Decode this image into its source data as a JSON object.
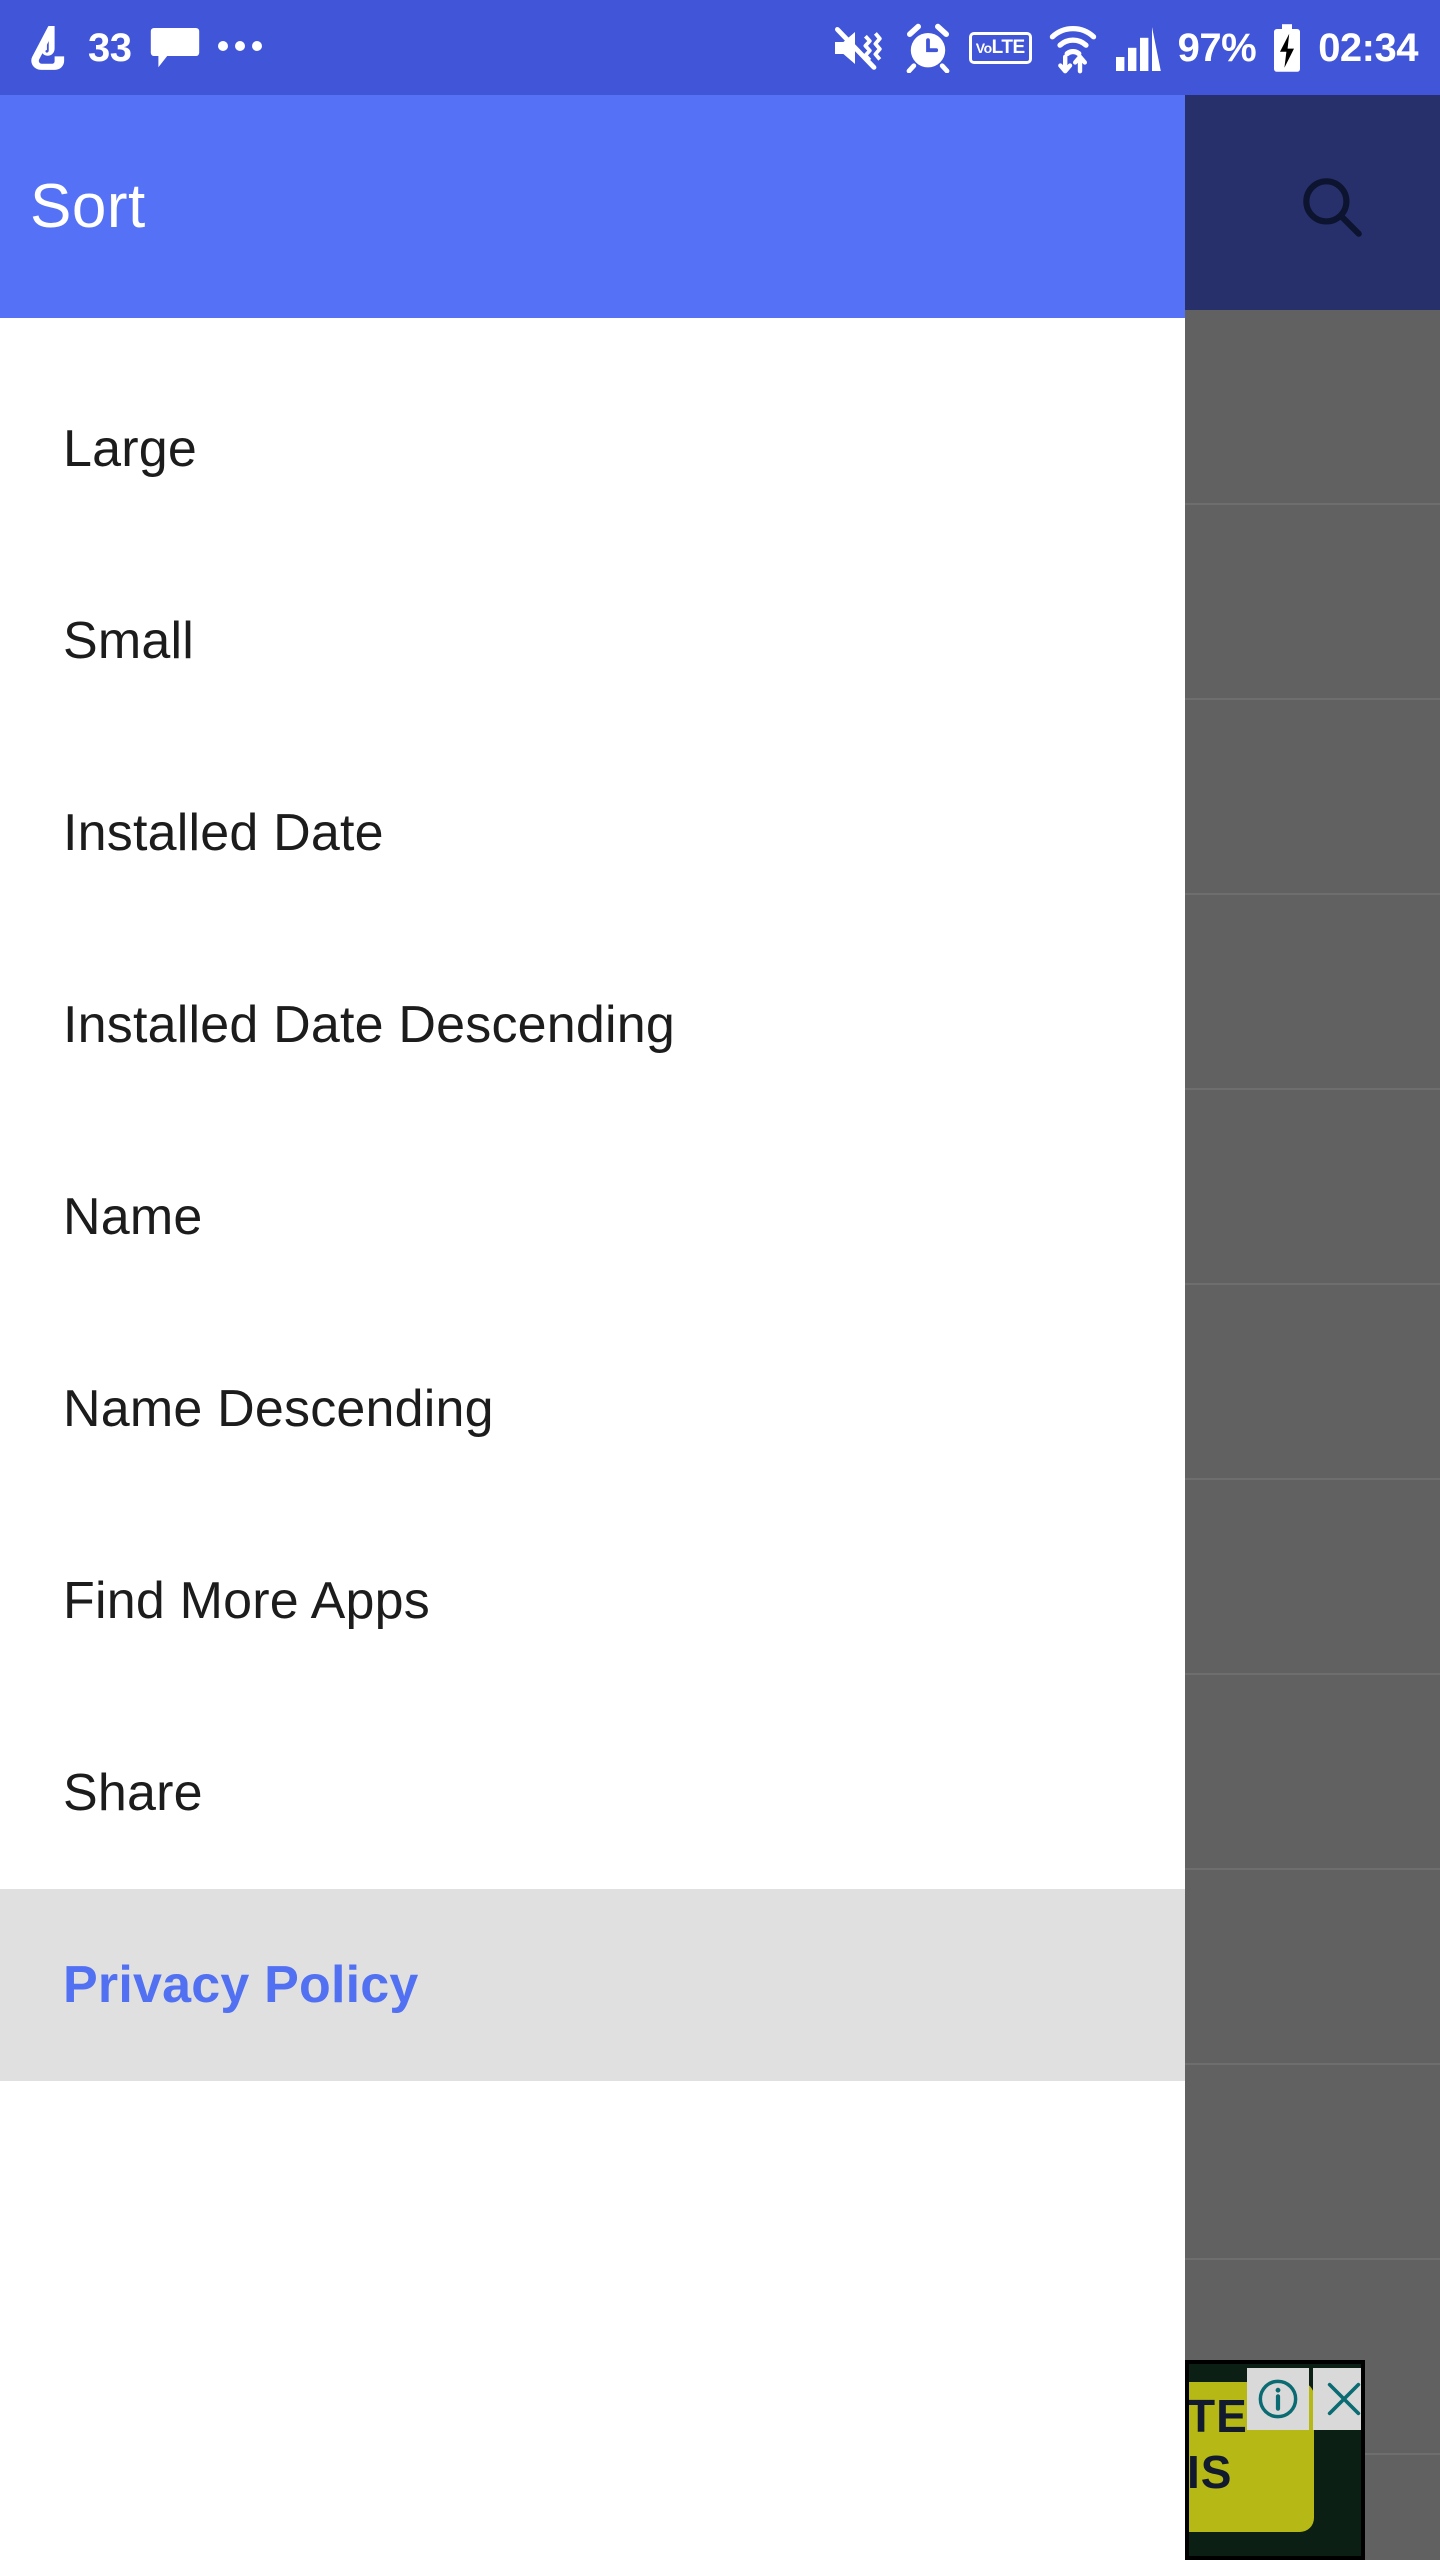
{
  "status_bar": {
    "background_color": "#4055d8",
    "left": {
      "app_icon": "app-notification-icon",
      "badge_count": "33",
      "message_icon": "message-bubble-icon",
      "overflow": "more-notifications-icon"
    },
    "right": {
      "mute_icon": "mute-vibrate-icon",
      "alarm_icon": "alarm-clock-icon",
      "volte_label_first": "Vo",
      "volte_label_second": "LTE",
      "wifi_icon": "wifi-data-transfer-icon",
      "signal_icon": "cellular-signal-icon",
      "battery_percent": "97%",
      "battery_icon": "battery-charging-icon",
      "clock": "02:34"
    }
  },
  "background": {
    "appbar_color": "#27306b",
    "scrim_color": "#616161",
    "search_icon": "search-icon",
    "row_count": 11
  },
  "ad": {
    "info_icon": "ad-info-icon",
    "close_icon": "ad-close-icon",
    "line1": "TE",
    "line2": "IS"
  },
  "drawer": {
    "header": {
      "title": "Sort",
      "background_color": "#5572f7",
      "title_color": "#ffffff"
    },
    "menu": [
      {
        "label": "Large",
        "state": "normal"
      },
      {
        "label": "Small",
        "state": "normal"
      },
      {
        "label": "Installed Date",
        "state": "normal"
      },
      {
        "label": "Installed Date Descending",
        "state": "normal"
      },
      {
        "label": "Name",
        "state": "normal"
      },
      {
        "label": "Name Descending",
        "state": "normal"
      },
      {
        "label": "Find More Apps",
        "state": "normal"
      },
      {
        "label": "Share",
        "state": "normal"
      },
      {
        "label": "Privacy Policy",
        "state": "highlighted-link"
      }
    ],
    "highlight_color": "#e0e0e0",
    "link_color": "#5271f2"
  }
}
